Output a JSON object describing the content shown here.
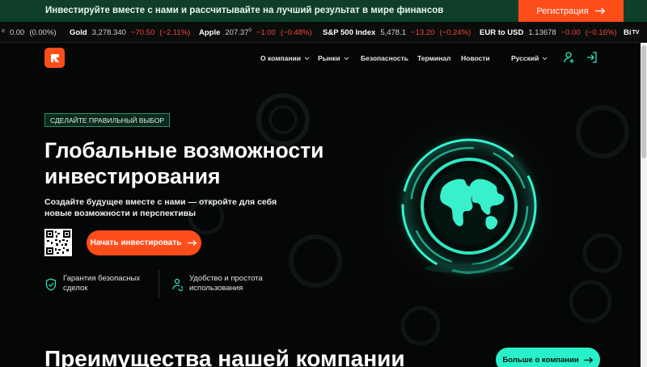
{
  "promo": {
    "text": "Инвестируйте вместе с нами и рассчитывайте на лучший результат в мире финансов",
    "button_label": "Регистрация"
  },
  "ticker": [
    {
      "name": "",
      "price": "0.00",
      "change": "",
      "pct": "(0.00%)",
      "partial_prefix": "⁰"
    },
    {
      "name": "Gold",
      "price": "3,278.340",
      "change": "−70.50",
      "pct": "(−2.11%)"
    },
    {
      "name": "Apple",
      "price": "207.37",
      "sup": "0",
      "change": "−1.00",
      "pct": "(−0.48%)"
    },
    {
      "name": "S&P 500 Index",
      "price": "5,478.1",
      "change": "−13.20",
      "pct": "(−0.24%)"
    },
    {
      "name": "EUR to USD",
      "price": "1.13678",
      "change": "−0.00",
      "pct": "(−0.16%)"
    },
    {
      "name": "Bi",
      "price": "",
      "change": "",
      "pct": ""
    }
  ],
  "nav": {
    "items": [
      {
        "label": "О компании",
        "dropdown": true
      },
      {
        "label": "Рынки",
        "dropdown": true
      },
      {
        "label": "Безопасность",
        "dropdown": false
      },
      {
        "label": "Терминал",
        "dropdown": false
      },
      {
        "label": "Новости",
        "dropdown": false
      }
    ],
    "language": "Русский"
  },
  "hero": {
    "badge": "СДЕЛАЙТЕ ПРАВИЛЬНЫЙ ВЫБОР",
    "title": "Глобальные возможности инвестирования",
    "subtitle": "Создайте будущее вместе с нами — откройте для себя новые возможности и перспективы",
    "cta_label": "Начать инвестировать",
    "features": [
      {
        "icon": "shield-check-icon",
        "text": "Гарантия безопасных\nсделок"
      },
      {
        "icon": "user-sync-icon",
        "text": "Удобство и простота\nиспользования"
      }
    ]
  },
  "section": {
    "title": "Преимущества нашей компании",
    "more_label": "Больше о компании"
  },
  "colors": {
    "accent": "#ff4d1a",
    "teal": "#28f0c8",
    "promo_bg": "#0f3f2a",
    "negative": "#f0483b"
  }
}
